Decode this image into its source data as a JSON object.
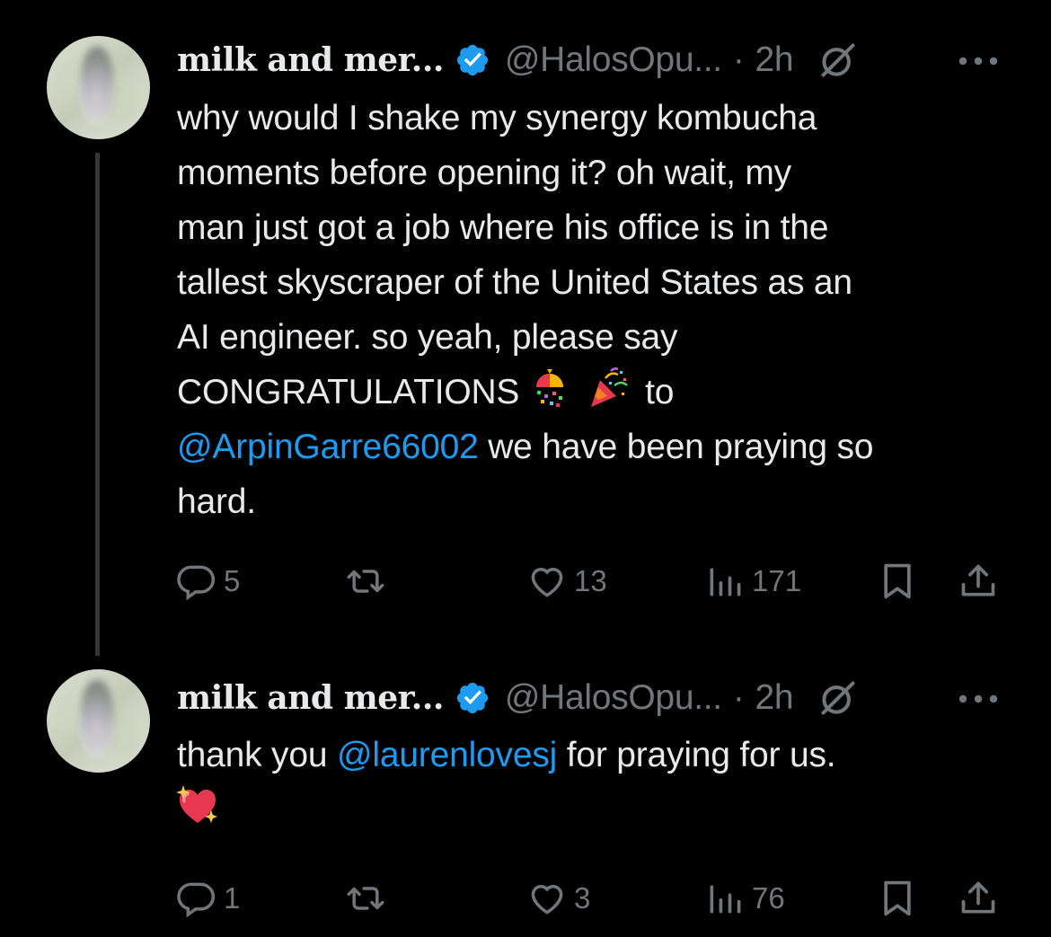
{
  "tweets": [
    {
      "author": {
        "name": "milk and mer...",
        "handle": "@HalosOpu...",
        "separator": "·",
        "time": "2h",
        "verified": true
      },
      "text": {
        "line1": "why would I shake my synergy kombucha",
        "line2": "moments before opening it? oh wait, my",
        "line3": "man just got a job where his office is in the",
        "line4": "tallest skyscraper of the United States as an",
        "line5": "AI engineer. so yeah, please say",
        "line6a": "CONGRATULATIONS",
        "line6b": "to",
        "line7_mention": "@ArpinGarre66002",
        "line7_rest": " we have been praying so",
        "line8": "hard."
      },
      "emojis": [
        "confetti-ball-emoji",
        "party-popper-emoji"
      ],
      "metrics": {
        "replies": "5",
        "reposts": "",
        "likes": "13",
        "views": "171"
      }
    },
    {
      "author": {
        "name": "milk and mer...",
        "handle": "@HalosOpu...",
        "separator": "·",
        "time": "2h",
        "verified": true
      },
      "text": {
        "pre": "thank you ",
        "mention": "@laurenlovesj",
        "post": " for praying for us."
      },
      "emojis": [
        "sparkling-heart-emoji"
      ],
      "metrics": {
        "replies": "1",
        "reposts": "",
        "likes": "3",
        "views": "76"
      }
    }
  ],
  "colors": {
    "background": "#000000",
    "text": "#e7e9ea",
    "secondary": "#71767b",
    "link": "#1d9bf0",
    "verified": "#1d9bf0",
    "thread_line": "#333639"
  }
}
